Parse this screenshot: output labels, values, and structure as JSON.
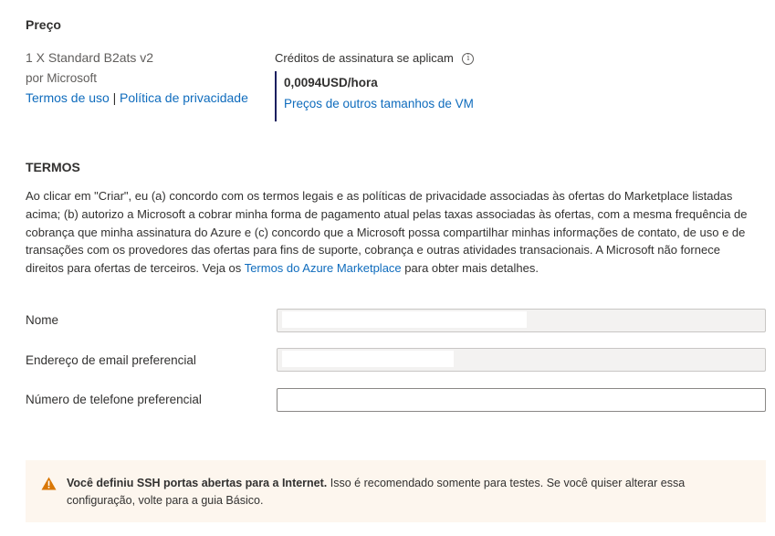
{
  "price": {
    "heading": "Preço",
    "product": "1 X Standard B2ats v2",
    "publisher": "por Microsoft",
    "terms_link": "Termos de uso",
    "separator": "|",
    "privacy_link": "Política de privacidade",
    "credits_text": "Créditos de assinatura se aplicam",
    "info_icon": "info-icon",
    "amount": "0,0094USD/hora",
    "other_sizes_link": "Preços de outros tamanhos de VM"
  },
  "terms": {
    "heading": "TERMOS",
    "paragraph_before_link": "Ao clicar em \"Criar\", eu (a) concordo com os termos legais e as políticas de privacidade associadas às ofertas do Marketplace listadas acima; (b) autorizo a Microsoft a cobrar minha forma de pagamento atual pelas taxas associadas às ofertas, com a mesma frequência de cobrança que minha assinatura do Azure e (c) concordo que a Microsoft possa compartilhar minhas informações de contato, de uso e de transações com os provedores das ofertas para fins de suporte, cobrança e outras atividades transacionais. A Microsoft não fornece direitos para ofertas de terceiros. Veja os",
    "marketplace_link": "Termos do Azure Marketplace",
    "paragraph_after_link": "para obter mais detalhes."
  },
  "form": {
    "name_label": "Nome",
    "email_label": "Endereço de email preferencial",
    "phone_label": "Número de telefone preferencial",
    "name_value": "",
    "email_value": "",
    "phone_value": ""
  },
  "warning": {
    "icon": "warning-triangle-icon",
    "bold_text": "Você definiu SSH portas abertas para a Internet.",
    "text": "Isso é recomendado somente para testes.  Se você quiser alterar essa configuração, volte para a guia Básico."
  },
  "colors": {
    "link": "#0f6cbd",
    "accent_border": "#1b1f5f",
    "warning_bg": "#fdf6ee",
    "warning_icon": "#d97706"
  }
}
